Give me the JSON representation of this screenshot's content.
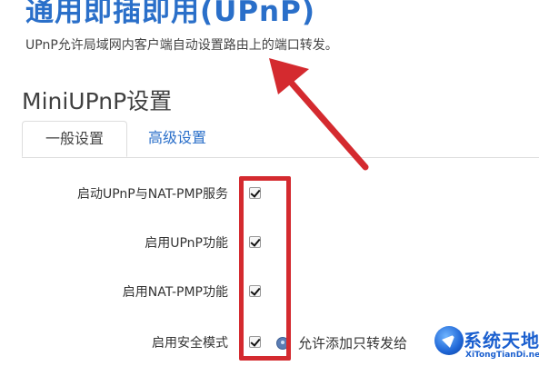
{
  "page": {
    "title": "通用即插即用(UPnP)",
    "description": "UPnP允许局域网内客户端自动设置路由上的端口转发。"
  },
  "section": {
    "title": "MiniUPnP设置"
  },
  "tabs": [
    {
      "label": "一般设置",
      "active": true
    },
    {
      "label": "高级设置",
      "active": false
    }
  ],
  "form": {
    "rows": [
      {
        "label": "启动UPnP与NAT-PMP服务",
        "checked": true
      },
      {
        "label": "启用UPnP功能",
        "checked": true
      },
      {
        "label": "启用NAT-PMP功能",
        "checked": true
      },
      {
        "label": "启用安全模式",
        "checked": true,
        "help_text": "允许添加只转发给"
      }
    ]
  },
  "watermark": {
    "name": "系统天地",
    "url": "XiTongTianDi.net"
  },
  "colors": {
    "title_blue": "#2a6fc9",
    "annotation_red": "#d42a2f"
  }
}
